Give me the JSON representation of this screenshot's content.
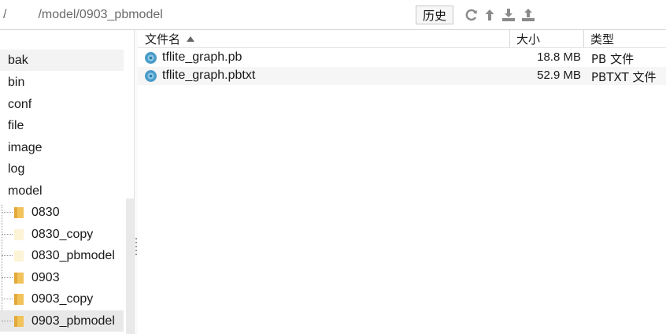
{
  "toolbar": {
    "path_value": "/         /model/0903_pbmodel",
    "history_label": "历史",
    "icons": [
      "refresh-icon",
      "up-arrow-icon",
      "download-icon",
      "upload-icon"
    ]
  },
  "sidebar": {
    "top_items": [
      "bak",
      "bin",
      "conf",
      "file",
      "image",
      "log",
      "model"
    ],
    "child_items": [
      "0830",
      "0830_copy",
      "0830_pbmodel",
      "0903",
      "0903_copy",
      "0903_pbmodel"
    ],
    "selected": "0903_pbmodel"
  },
  "filelist": {
    "columns": {
      "name": "文件名",
      "size": "大小",
      "type": "类型"
    },
    "sort": "name-ascending",
    "rows": [
      {
        "name": "tflite_graph.pb",
        "size": "18.8 MB",
        "type": "PB 文件"
      },
      {
        "name": "tflite_graph.pbtxt",
        "size": "52.9 MB",
        "type": "PBTXT 文件"
      }
    ]
  },
  "colors": {
    "folder": "#f2c25b",
    "file_icon": "#4a9cc9",
    "selection": "#e8e8e8"
  }
}
